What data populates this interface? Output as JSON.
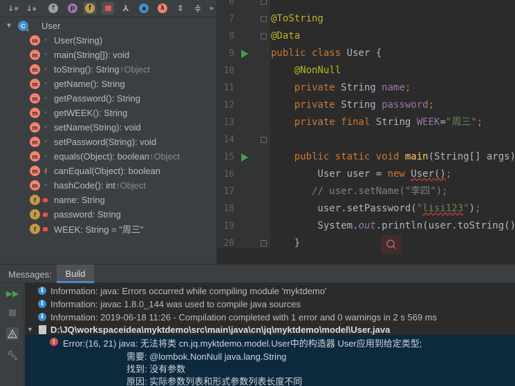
{
  "structure": {
    "toolbar": [
      "sort-visibility-icon",
      "sort-alpha-icon",
      "inherited-icon",
      "properties-icon",
      "fields-icon",
      "non-public-icon",
      "hierarchy-icon",
      "anonymous-icon",
      "lambda-icon",
      "expand-all-icon",
      "collapse-all-icon",
      "more-icon"
    ],
    "root": "User",
    "members": [
      {
        "text": "User(String)",
        "inherit": "",
        "kind": "m",
        "vis": "pub"
      },
      {
        "text": "main(String[]): void",
        "inherit": "",
        "kind": "m",
        "vis": "pub"
      },
      {
        "text": "toString(): String ",
        "inherit": "↑Object",
        "kind": "m",
        "vis": "pub"
      },
      {
        "text": "getName(): String",
        "inherit": "",
        "kind": "m",
        "vis": "pub"
      },
      {
        "text": "getPassword(): String",
        "inherit": "",
        "kind": "m",
        "vis": "pub"
      },
      {
        "text": "getWEEK(): String",
        "inherit": "",
        "kind": "m",
        "vis": "pub"
      },
      {
        "text": "setName(String): void",
        "inherit": "",
        "kind": "m",
        "vis": "pub"
      },
      {
        "text": "setPassword(String): void",
        "inherit": "",
        "kind": "m",
        "vis": "pub"
      },
      {
        "text": "equals(Object): boolean ",
        "inherit": "↑Object",
        "kind": "m",
        "vis": "pub"
      },
      {
        "text": "canEqual(Object): boolean",
        "inherit": "",
        "kind": "m",
        "vis": "prot"
      },
      {
        "text": "hashCode(): int ",
        "inherit": "↑Object",
        "kind": "m",
        "vis": "pub"
      },
      {
        "text": "name: String",
        "inherit": "",
        "kind": "f",
        "vis": "priv"
      },
      {
        "text": "password: String",
        "inherit": "",
        "kind": "f",
        "vis": "priv"
      },
      {
        "text": "WEEK: String = \"周三\"",
        "inherit": "",
        "kind": "f",
        "vis": "priv"
      }
    ]
  },
  "editor": {
    "lines": [
      {
        "n": "6",
        "html": ""
      },
      {
        "n": "7",
        "html": "<span class='ann'>@ToString</span>"
      },
      {
        "n": "8",
        "html": "<span class='ann'>@Data</span>"
      },
      {
        "n": "9",
        "html": "<span class='kw'>public class </span>User {"
      },
      {
        "n": "10",
        "html": "    <span class='ann'>@NonNull</span>"
      },
      {
        "n": "11",
        "html": "    <span class='kw'>private </span>String <span class='fld'>name</span><span class='kw'>;</span>"
      },
      {
        "n": "12",
        "html": "    <span class='kw'>private </span>String <span class='fld'>password</span><span class='kw'>;</span>"
      },
      {
        "n": "13",
        "html": "    <span class='kw'>private final </span>String <span class='fld'>WEEK</span>=<span class='str'>\"周三\"</span><span class='kw'>;</span>"
      },
      {
        "n": "14",
        "html": ""
      },
      {
        "n": "15",
        "html": "    <span class='kw'>public static void </span><span class='fn'>main</span>(String[] args) {"
      },
      {
        "n": "16",
        "html": "        User user = <span class='kw'>new </span><span class='squig'>User()</span><span class='kw'>;</span>"
      },
      {
        "n": "17",
        "html": "       <span class='cmt'>// user.setName(\"李四\");</span>"
      },
      {
        "n": "18",
        "html": "        user.setPassword(<span class='str'>\"<span class='squig'>lisi123</span>\"</span>)<span class='kw'>;</span>"
      },
      {
        "n": "19",
        "html": "        System.<span class='fld itl'>out</span>.println(user.toString())<span class='kw'>;</span>"
      },
      {
        "n": "20",
        "html": "    }"
      }
    ]
  },
  "bottom": {
    "label": "Messages:",
    "tab": "Build",
    "messages": [
      "Information: java: Errors occurred while compiling module 'myktdemo'",
      "Information: javac 1.8.0_144 was used to compile java sources",
      "Information: 2019-06-18 11:26 - Compilation completed with 1 error and 0 warnings in 2 s 569 ms"
    ],
    "file": "D:\\JQ\\workspaceidea\\myktdemo\\src\\main\\java\\cn\\jq\\myktdemo\\model\\User.java",
    "error": {
      "head": "Error:(16, 21)  java: 无法将类 cn.jq.myktdemo.model.User中的构造器 User应用到给定类型;",
      "required": "需要: @lombok.NonNull java.lang.String",
      "found": "找到: 没有参数",
      "reason": "原因: 实际参数列表和形式参数列表长度不同"
    }
  }
}
